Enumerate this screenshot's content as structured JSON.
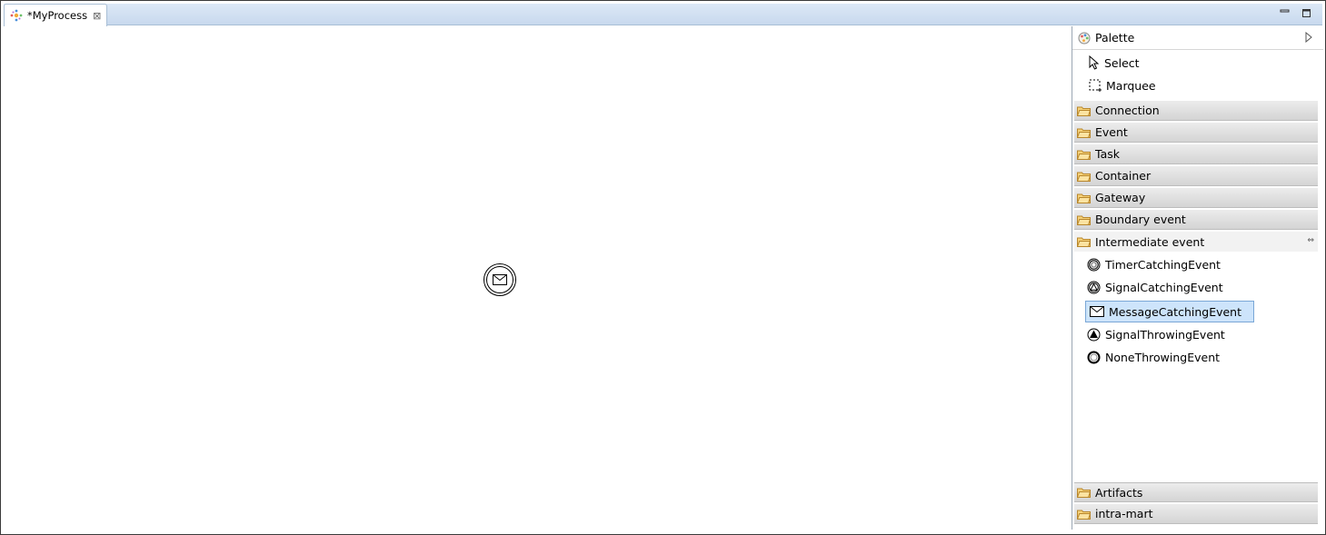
{
  "editor": {
    "tab_label": "*MyProcess",
    "close_glyph": "⊠",
    "minimize_glyph": "▭",
    "maximize_glyph": "□"
  },
  "canvas": {
    "nodes": [
      {
        "type": "MessageCatchingEvent",
        "icon": "envelope-icon"
      }
    ]
  },
  "palette": {
    "title": "Palette",
    "tools": [
      {
        "label": "Select",
        "icon": "arrow-pointer-icon"
      },
      {
        "label": "Marquee",
        "icon": "marquee-icon"
      }
    ],
    "drawers_top": [
      {
        "label": "Connection"
      },
      {
        "label": "Event"
      },
      {
        "label": "Task"
      },
      {
        "label": "Container"
      },
      {
        "label": "Gateway"
      },
      {
        "label": "Boundary event"
      }
    ],
    "open_drawer": {
      "label": "Intermediate event",
      "pin_glyph": "⇔",
      "entries": [
        {
          "label": "TimerCatchingEvent",
          "icon": "timer-event-icon"
        },
        {
          "label": "SignalCatchingEvent",
          "icon": "signal-event-icon"
        },
        {
          "label": "MessageCatchingEvent",
          "icon": "message-event-icon",
          "selected": true
        },
        {
          "label": "SignalThrowingEvent",
          "icon": "signal-throw-event-icon"
        },
        {
          "label": "NoneThrowingEvent",
          "icon": "none-throw-event-icon"
        }
      ]
    },
    "drawers_bottom": [
      {
        "label": "Artifacts"
      },
      {
        "label": "intra-mart"
      }
    ]
  },
  "colors": {
    "selection": "#cde4fb",
    "folder": "#e8b94a",
    "tabbar": "#dce8f6"
  }
}
